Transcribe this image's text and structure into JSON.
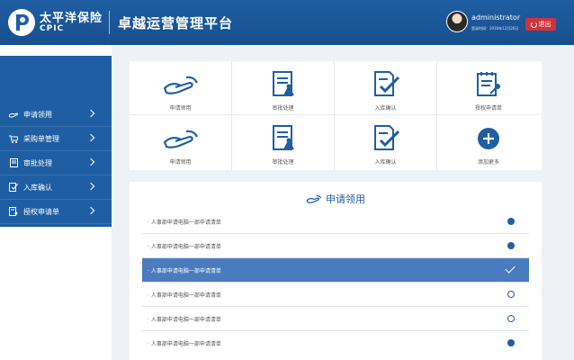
{
  "header": {
    "brand_cn": "太平洋保险",
    "brand_en": "CPIC",
    "app_title": "卓越运营管理平台",
    "username": "administrator",
    "login_time": "登录时间：2016年12月28日",
    "logout_label": "退出",
    "accent": "#1f5ea3",
    "logout_color": "#d0333a"
  },
  "sidebar": {
    "items": [
      {
        "label": "申请领用",
        "icon": "hand-icon"
      },
      {
        "label": "采购单管理",
        "icon": "cart-icon"
      },
      {
        "label": "审批处理",
        "icon": "document-icon"
      },
      {
        "label": "入库确认",
        "icon": "checklist-icon"
      },
      {
        "label": "授权申请单",
        "icon": "key-document-icon"
      }
    ]
  },
  "grid": {
    "cells": [
      {
        "label": "申请领用",
        "icon": "hand-icon"
      },
      {
        "label": "审批处理",
        "icon": "document-icon"
      },
      {
        "label": "入库确认",
        "icon": "checklist-icon"
      },
      {
        "label": "授权申请单",
        "icon": "key-document-icon"
      },
      {
        "label": "申请领用",
        "icon": "hand-icon"
      },
      {
        "label": "审批处理",
        "icon": "document-icon"
      },
      {
        "label": "入库确认",
        "icon": "checklist-icon"
      },
      {
        "label": "添加更多",
        "icon": "plus-circle-icon"
      }
    ]
  },
  "panel": {
    "title": "申请领用",
    "rows": [
      {
        "text": "人事部申请电脑一部申请清单",
        "state": "filled"
      },
      {
        "text": "人事部申请电脑一部申请清单",
        "state": "filled"
      },
      {
        "text": "人事部申请电脑一部申请清单",
        "state": "selected"
      },
      {
        "text": "人事部申请电脑一部申请清单",
        "state": "empty"
      },
      {
        "text": "人事部申请电脑一部申请清单",
        "state": "empty"
      },
      {
        "text": "人事部申请电脑一部申请清单",
        "state": "filled"
      }
    ]
  }
}
